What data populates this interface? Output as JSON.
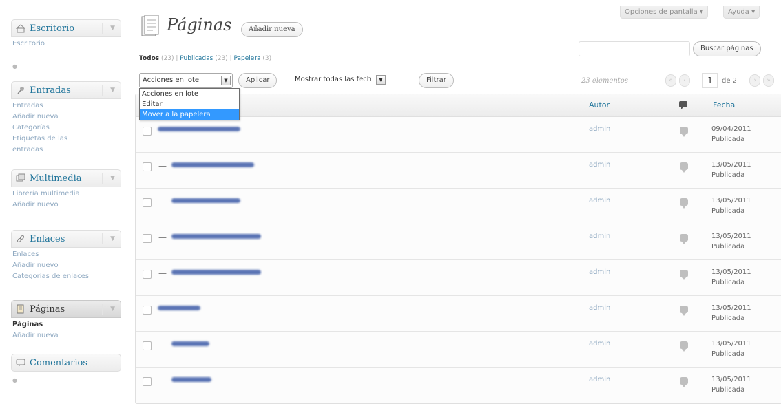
{
  "sidebar": {
    "escritorio": {
      "title": "Escritorio",
      "items": [
        "Escritorio"
      ]
    },
    "entradas": {
      "title": "Entradas",
      "items": [
        "Entradas",
        "Añadir nueva",
        "Categorías",
        "Etiquetas de las",
        "entradas"
      ]
    },
    "multimedia": {
      "title": "Multimedia",
      "items": [
        "Librería multimedia",
        "Añadir nuevo"
      ]
    },
    "enlaces": {
      "title": "Enlaces",
      "items": [
        "Enlaces",
        "Añadir nuevo",
        "Categorías de enlaces"
      ]
    },
    "paginas": {
      "title": "Páginas",
      "items": [
        "Páginas",
        "Añadir nueva"
      ]
    },
    "comentarios": {
      "title": "Comentarios"
    }
  },
  "header": {
    "screen_options": "Opciones de pantalla",
    "help": "Ayuda",
    "title": "Páginas",
    "add_new": "Añadir nueva"
  },
  "filters": {
    "all": "Todos",
    "all_count": "(23)",
    "published": "Publicadas",
    "published_count": "(23)",
    "trash": "Papelera",
    "trash_count": "(3)",
    "sep": "|"
  },
  "search": {
    "button": "Buscar páginas",
    "value": ""
  },
  "bulk": {
    "selected": "Acciones en lote",
    "apply": "Aplicar",
    "dates": "Mostrar todas las fech",
    "filter": "Filtrar",
    "options": [
      "Acciones en lote",
      "Editar",
      "Mover a la papelera"
    ],
    "highlighted_index": 2
  },
  "pagination": {
    "count_text": "23 elementos",
    "first": "«",
    "prev": "‹",
    "current": "1",
    "of_text": "de 2",
    "next": "›",
    "last": "»"
  },
  "table": {
    "columns": {
      "author": "Autor",
      "date": "Fecha"
    },
    "rows": [
      {
        "prefix": "",
        "blur_width": 120,
        "author": "admin",
        "date": "09/04/2011",
        "status": "Publicada"
      },
      {
        "prefix": "—",
        "blur_width": 120,
        "author": "admin",
        "date": "13/05/2011",
        "status": "Publicada"
      },
      {
        "prefix": "—",
        "blur_width": 100,
        "author": "admin",
        "date": "13/05/2011",
        "status": "Publicada"
      },
      {
        "prefix": "—",
        "blur_width": 130,
        "author": "admin",
        "date": "13/05/2011",
        "status": "Publicada"
      },
      {
        "prefix": "—",
        "blur_width": 130,
        "author": "admin",
        "date": "13/05/2011",
        "status": "Publicada"
      },
      {
        "prefix": "",
        "blur_width": 62,
        "author": "admin",
        "date": "13/05/2011",
        "status": "Publicada"
      },
      {
        "prefix": "—",
        "blur_width": 55,
        "author": "admin",
        "date": "13/05/2011",
        "status": "Publicada"
      },
      {
        "prefix": "—",
        "blur_width": 58,
        "author": "admin",
        "date": "13/05/2011",
        "status": "Publicada"
      }
    ]
  },
  "colors": {
    "link": "#21759b",
    "highlight": "#3399ff",
    "blur_title": "#5a74b4"
  }
}
